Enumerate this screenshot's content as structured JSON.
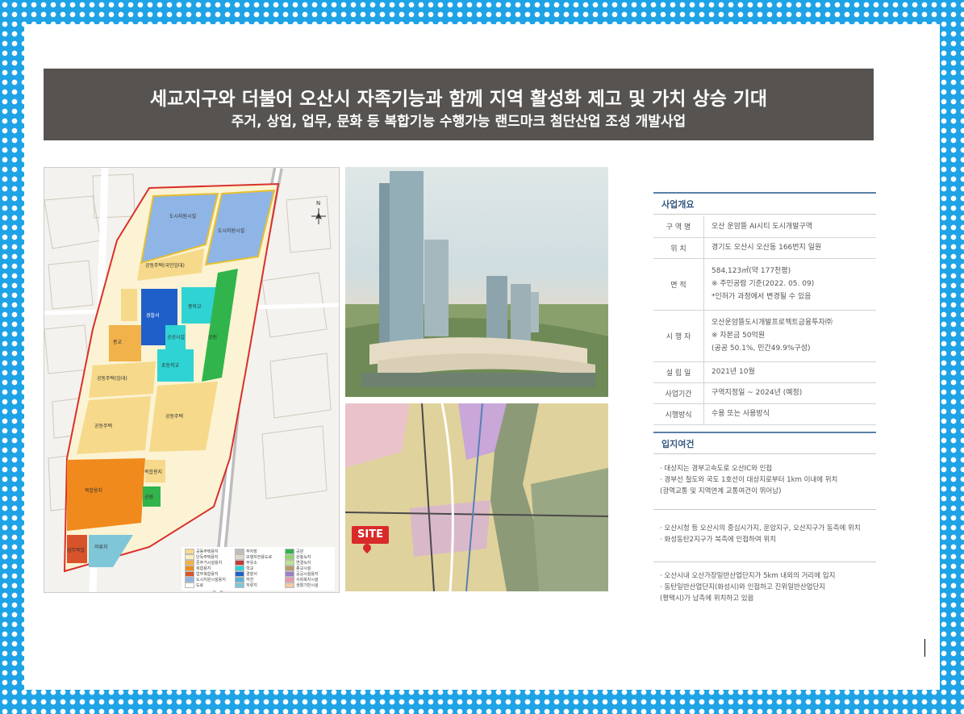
{
  "banner": {
    "title": "세교지구와 더불어 오산시 자족기능과 함께 지역 활성화 제고 및 가치 상승 기대",
    "subtitle": "주거, 상업, 업무, 문화 등 복합기능 수행가능 랜드마크 첨단산업 조성 개발사업"
  },
  "map": {
    "labels": {
      "city_support_1": "도시지원시설",
      "city_support_2": "도시지원시설",
      "public_housing_national": "공동주택(국민임대)",
      "cultural_park": "문화공원",
      "police": "경찰서",
      "middle_school": "중학교",
      "public_facility": "공공시설",
      "park": "공원",
      "religious": "종교",
      "commercial": "종교시설",
      "elementary": "초등학교",
      "public_housing_rental": "공동주택(임대)",
      "public_housing_1": "공동주택",
      "public_housing_2": "공동주택",
      "complex_land": "복합용지",
      "complex_land_small": "복합용지",
      "park_2": "공원",
      "office_complex": "업무복합",
      "reservoir": "저류지",
      "north": "N"
    },
    "legend": [
      {
        "label": "공동주택용지",
        "color": "#f6d98a"
      },
      {
        "label": "단독주택용지",
        "color": "#fbeec0"
      },
      {
        "label": "준주거시설용지",
        "color": "#f2b24a"
      },
      {
        "label": "복합용지",
        "color": "#f08a1c"
      },
      {
        "label": "업무복합용지",
        "color": "#d9532a"
      },
      {
        "label": "도시지원시설용지",
        "color": "#8fb4e6"
      },
      {
        "label": "도로",
        "color": "#ffffff"
      },
      {
        "label": "주차장",
        "color": "#bdbdbd"
      },
      {
        "label": "보행자전용도로",
        "color": "#e0d8c8"
      },
      {
        "label": "주유소",
        "color": "#c33a3a"
      },
      {
        "label": "학교",
        "color": "#2fd3d3"
      },
      {
        "label": "경찰서",
        "color": "#1f5fc9"
      },
      {
        "label": "하천",
        "color": "#5ab1d8"
      },
      {
        "label": "저류지",
        "color": "#7fc6d8"
      },
      {
        "label": "공원",
        "color": "#31b44b"
      },
      {
        "label": "완충녹지",
        "color": "#8fd46c"
      },
      {
        "label": "연결녹지",
        "color": "#b9e38e"
      },
      {
        "label": "종교시설",
        "color": "#b89a6a"
      },
      {
        "label": "공공시설용지",
        "color": "#9a7fc2"
      },
      {
        "label": "사회복지시설",
        "color": "#e89bb0"
      },
      {
        "label": "생활기반시설",
        "color": "#f2c8a0"
      }
    ]
  },
  "sitemap": {
    "badge": "SITE"
  },
  "overview": {
    "title": "사업개요",
    "rows": [
      {
        "key": "구 역 명",
        "lines": [
          "오산 운암뜰 AI시티 도시개발구역"
        ]
      },
      {
        "key": "위    치",
        "lines": [
          "경기도 오산시 오산동 166번지 일원"
        ]
      },
      {
        "key": "면    적",
        "lines": [
          "584,123㎡(약 177천평)",
          "※ 주민공람 기준(2022. 05. 09)",
          "*인허가 과정에서 변경될 수 있음"
        ]
      },
      {
        "key": "시 행 자",
        "lines": [
          "오산운암뜰도시개발프로젝트금융투자㈜",
          "※ 자본금 50억원",
          "(공공 50.1%, 민간49.9%구성)"
        ]
      },
      {
        "key": "설 립 일",
        "lines": [
          "2021년 10월"
        ]
      },
      {
        "key": "사업기간",
        "lines": [
          "구역지정일 ~ 2024년 (예정)"
        ]
      },
      {
        "key": "시행방식",
        "lines": [
          "수용 또는 사용방식"
        ]
      }
    ]
  },
  "location": {
    "title": "입지여건",
    "groups": [
      [
        "· 대상지는 경부고속도로 오산IC와 인접",
        "· 경부선 철도와 국도 1호선이 대상지로부터 1km 이내에 위치",
        "  (광역교통 및 지역연계 교통여건이 뛰어남)"
      ],
      [
        "· 오산시청 등 오산시의 중심시가지, 운암지구, 오산지구가 동측에 위치",
        "· 화성동탄2지구가 북측에 인접하여 위치"
      ],
      [
        "· 오산시내 오산가장일반산업단지가 5km 내외의 거리에 입지",
        "· 동탄일반산업단지(화성시)와 인접하고 진위일반산업단지",
        "  (평택시)가 남측에 위치하고 있음"
      ]
    ]
  }
}
